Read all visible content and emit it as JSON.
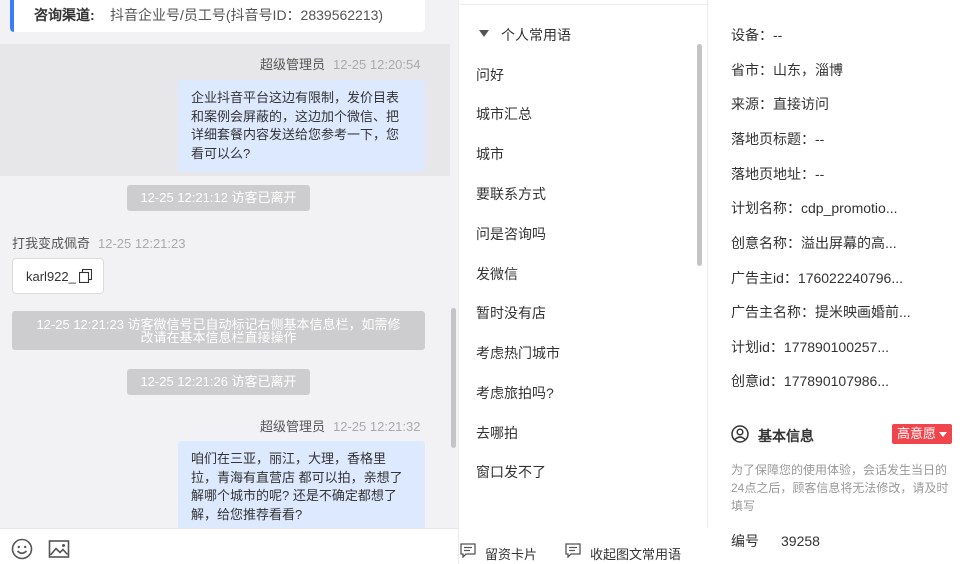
{
  "chat": {
    "channel": {
      "label": "咨询渠道:",
      "value": "抖音企业号/员工号(抖音号ID：2839562213)"
    },
    "messages": [
      {
        "sender": "超级管理员",
        "time": "12-25 12:20:54",
        "text": [
          "企业抖音平台这边有限制，发价目表",
          "和案例会屏蔽的，这边加个微信、把",
          "详细套餐内容发送给您参考一下，您",
          "看可以么?"
        ]
      },
      {
        "sender": "超级管理员",
        "time": "12-25 12:21:32",
        "text": [
          "咱们在三亚，丽江，大理，香格里",
          "拉，青海有直营店 都可以拍，亲想了",
          "解哪个城市的呢? 还是不确定都想了",
          "解，给您推荐看看?"
        ]
      }
    ],
    "system": {
      "left1": "12-25 12:21:12 访客已离开",
      "auto_tag_line1": "12-25 12:21:23 访客微信号已自动标记右侧基本信息栏，如需修",
      "auto_tag_line2": "改请在基本信息栏直接操作",
      "left2": "12-25 12:21:26 访客已离开"
    },
    "visitor": {
      "name": "打我变成佩奇",
      "time": "12-25 12:21:23",
      "wechat": "karl922_"
    }
  },
  "phrases": {
    "group": "个人常用语",
    "items": [
      "问好",
      "城市汇总",
      "城市",
      "要联系方式",
      "问是咨询吗",
      "发微信",
      "暂时没有店",
      "考虑热门城市",
      "考虑旅拍吗?",
      "去哪拍",
      "窗口发不了"
    ],
    "footer": {
      "card": "留资卡片",
      "collapse": "收起图文常用语"
    }
  },
  "info": {
    "rows": [
      {
        "k": "设备：",
        "v": "--"
      },
      {
        "k": "省市：",
        "v": "山东，淄博"
      },
      {
        "k": "来源：",
        "v": "直接访问"
      },
      {
        "k": "落地页标题：",
        "v": "--"
      },
      {
        "k": "落地页地址：",
        "v": "--"
      },
      {
        "k": "计划名称：",
        "v": "cdp_promotio..."
      },
      {
        "k": "创意名称：",
        "v": "溢出屏幕的高..."
      },
      {
        "k": "广告主id：",
        "v": "176022240796..."
      },
      {
        "k": "广告主名称：",
        "v": "提米映画婚前..."
      },
      {
        "k": "计划id：",
        "v": "177890100257..."
      },
      {
        "k": "创意id：",
        "v": "177890107986..."
      }
    ],
    "basic": {
      "title": "基本信息",
      "tag": "高意愿",
      "notice": "为了保障您的使用体验，会话发生当日的24点之后，顾客信息将无法修改，请及时填写",
      "id_label": "编号",
      "id_value": "39258"
    },
    "colors": {
      "accent": "#3b7cff",
      "tag": "#f0454c",
      "bubble": "#dde9ff"
    }
  }
}
